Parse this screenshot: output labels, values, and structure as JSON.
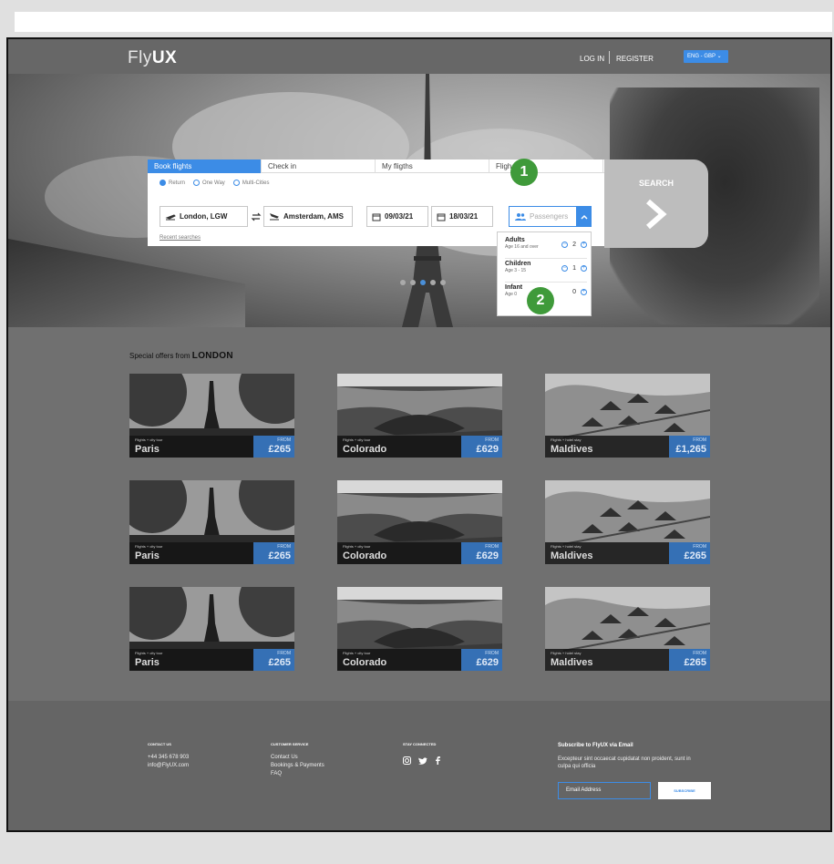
{
  "header": {
    "logo_light": "Fly",
    "logo_bold": "UX",
    "login": "LOG IN",
    "register": "REGISTER",
    "language": "ENG - GBP"
  },
  "search_widget": {
    "tabs": [
      "Book flights",
      "Check in",
      "My fligths",
      "Fligh"
    ],
    "trip_types": [
      "Return",
      "One Way",
      "Multi-Cities"
    ],
    "selected_trip_type": "Return",
    "from": "London, LGW",
    "to": "Amsterdam, AMS",
    "depart_date": "09/03/21",
    "return_date": "18/03/21",
    "passengers_placeholder": "Passengers",
    "recent_searches": "Recent searches",
    "search_button": "SEARCH"
  },
  "passengers": [
    {
      "label": "Adults",
      "sub": "Age 16 and over",
      "count": "2"
    },
    {
      "label": "Children",
      "sub": "Age 3 - 15",
      "count": "1"
    },
    {
      "label": "Infant",
      "sub": "Age 0",
      "count": "0"
    }
  ],
  "markers": [
    "1",
    "2"
  ],
  "offers": {
    "title_prefix": "Special offers from",
    "title_city": "LONDON",
    "from_label": "FROM",
    "cards": [
      {
        "type": "Flights + city tour",
        "city": "Paris",
        "price": "£265"
      },
      {
        "type": "Flights + city tour",
        "city": "Colorado",
        "price": "£629"
      },
      {
        "type": "Flights + hotel stay",
        "city": "Maldives",
        "price": "£1,265"
      },
      {
        "type": "Flights + city tour",
        "city": "Paris",
        "price": "£265"
      },
      {
        "type": "Flights + city tour",
        "city": "Colorado",
        "price": "£629"
      },
      {
        "type": "Flights + hotel stay",
        "city": "Maldives",
        "price": "£265"
      },
      {
        "type": "Flights + city tour",
        "city": "Paris",
        "price": "£265"
      },
      {
        "type": "Flights + city tour",
        "city": "Colorado",
        "price": "£629"
      },
      {
        "type": "Flights + hotel stay",
        "city": "Maldives",
        "price": "£265"
      }
    ]
  },
  "footer": {
    "contact_heading": "CONTACT US",
    "phone": "+44 345 678 903",
    "email": "info@FlyUX.com",
    "service_heading": "CUSTOMER SERVICE",
    "service_links": [
      "Contact Us",
      "Bookings & Payments",
      "FAQ"
    ],
    "social_heading": "STAY CONNECTED",
    "subscribe_title": "Subscribe to FlyUX via Email",
    "subscribe_text": "Excepteur sint occaecat cupidatat non proident, sunt in culpa qui officia",
    "email_placeholder": "Email Address",
    "subscribe_button": "SUBSCRIBE"
  },
  "colors": {
    "accent": "#3c8ce6",
    "badge": "#3f9a3a",
    "price_box": "#3570b5"
  }
}
